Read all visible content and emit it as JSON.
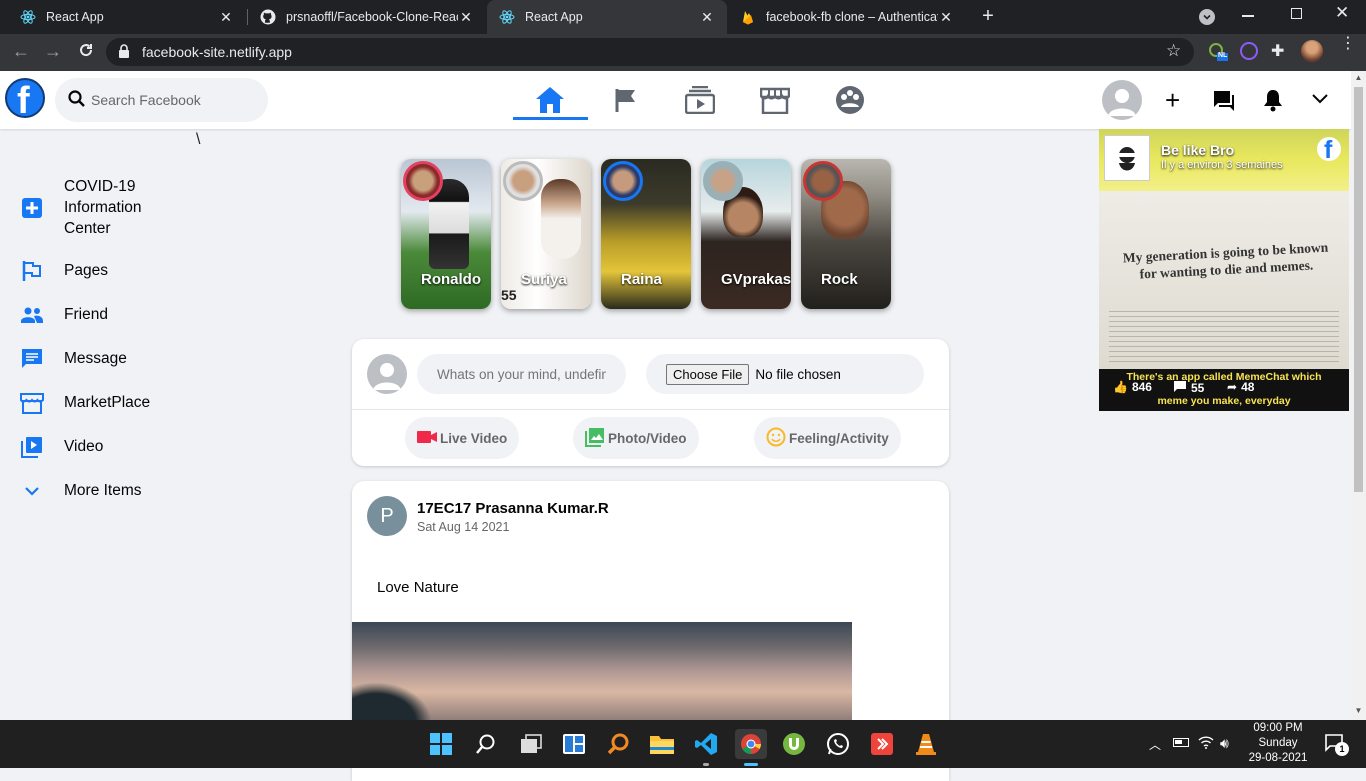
{
  "browser": {
    "tabs": [
      {
        "title": "React App"
      },
      {
        "title": "prsnaoffl/Facebook-Clone-React"
      },
      {
        "title": "React App"
      },
      {
        "title": "facebook-fb clone – Authenticati"
      }
    ],
    "url": "facebook-site.netlify.app",
    "extension_badge": "NL"
  },
  "header": {
    "search_placeholder": "Search Facebook"
  },
  "sidebar": {
    "items": [
      {
        "label": "COVID-19 Information Center",
        "icon": "plus-square-icon"
      },
      {
        "label": "Pages",
        "icon": "flag-icon"
      },
      {
        "label": "Friend",
        "icon": "people-icon"
      },
      {
        "label": "Message",
        "icon": "message-icon"
      },
      {
        "label": "MarketPlace",
        "icon": "storefront-icon"
      },
      {
        "label": "Video",
        "icon": "video-library-icon"
      },
      {
        "label": "More Items",
        "icon": "chevron-down-icon"
      }
    ],
    "stray_char": "\\"
  },
  "stories": [
    {
      "name": "Ronaldo"
    },
    {
      "name": "Suriya"
    },
    {
      "name": "Raina"
    },
    {
      "name": "GVprakash"
    },
    {
      "name": "Rock"
    }
  ],
  "composer": {
    "placeholder": "Whats on your mind, undefined",
    "file_button": "Choose File",
    "file_status": "No file chosen",
    "actions": [
      {
        "label": "Live Video",
        "color": "#f02849"
      },
      {
        "label": "Photo/Video",
        "color": "#45bd62"
      },
      {
        "label": "Feeling/Activity",
        "color": "#f7b928"
      }
    ]
  },
  "post": {
    "avatar_letter": "P",
    "author": "17EC17 Prasanna Kumar.R",
    "date": "Sat Aug 14 2021",
    "text": "Love Nature"
  },
  "ad": {
    "page_name": "Be like Bro",
    "subtitle": "Il y a environ 3 semaines",
    "quote": "My generation is going to be known for wanting to die and memes.",
    "caption": "There's an app called MemeChat which",
    "caption2": "meme you make, everyday",
    "likes": "846",
    "comments": "55",
    "shares": "48"
  },
  "taskbar": {
    "time": "09:00 PM",
    "day": "Sunday",
    "date": "29-08-2021",
    "notif_count": "1"
  },
  "colors": {
    "fb_blue": "#1877f2",
    "bg": "#f0f2f5"
  }
}
